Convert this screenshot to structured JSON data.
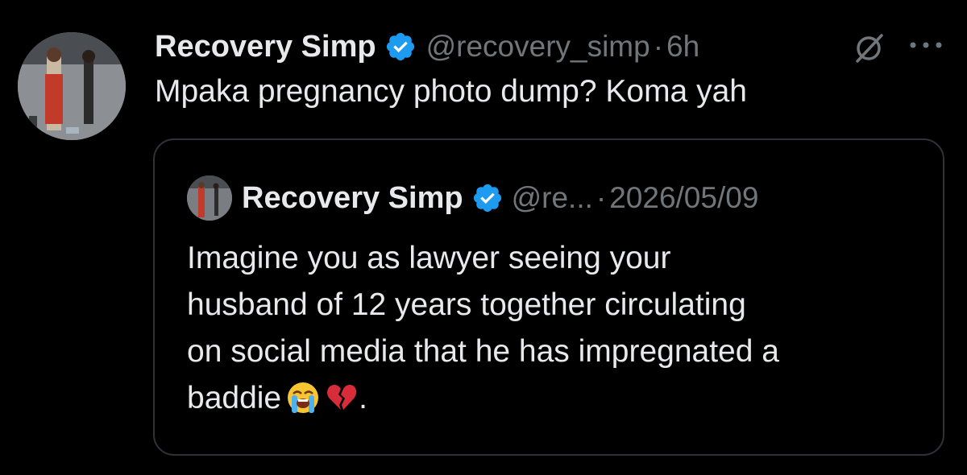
{
  "tweet": {
    "author_name": "Recovery Simp",
    "handle": "@recovery_simp",
    "separator": "·",
    "time": "6h",
    "text": "Mpaka pregnancy photo dump? Koma yah",
    "verified_icon": "verified-badge-icon",
    "grok_icon": "grok-icon",
    "more_icon": "more-options-icon",
    "accent_color": "#1d9bf0"
  },
  "quote": {
    "author_name": "Recovery Simp",
    "handle": "@re...",
    "separator": "·",
    "date": "2026/05/09",
    "lines": [
      "Imagine you as lawyer seeing your",
      "husband of 12 years together circulating",
      "on social media that he has impregnated a",
      "baddie"
    ],
    "emojis": [
      "loudly-crying-face-emoji",
      "broken-heart-emoji"
    ],
    "end_punctuation": "."
  }
}
